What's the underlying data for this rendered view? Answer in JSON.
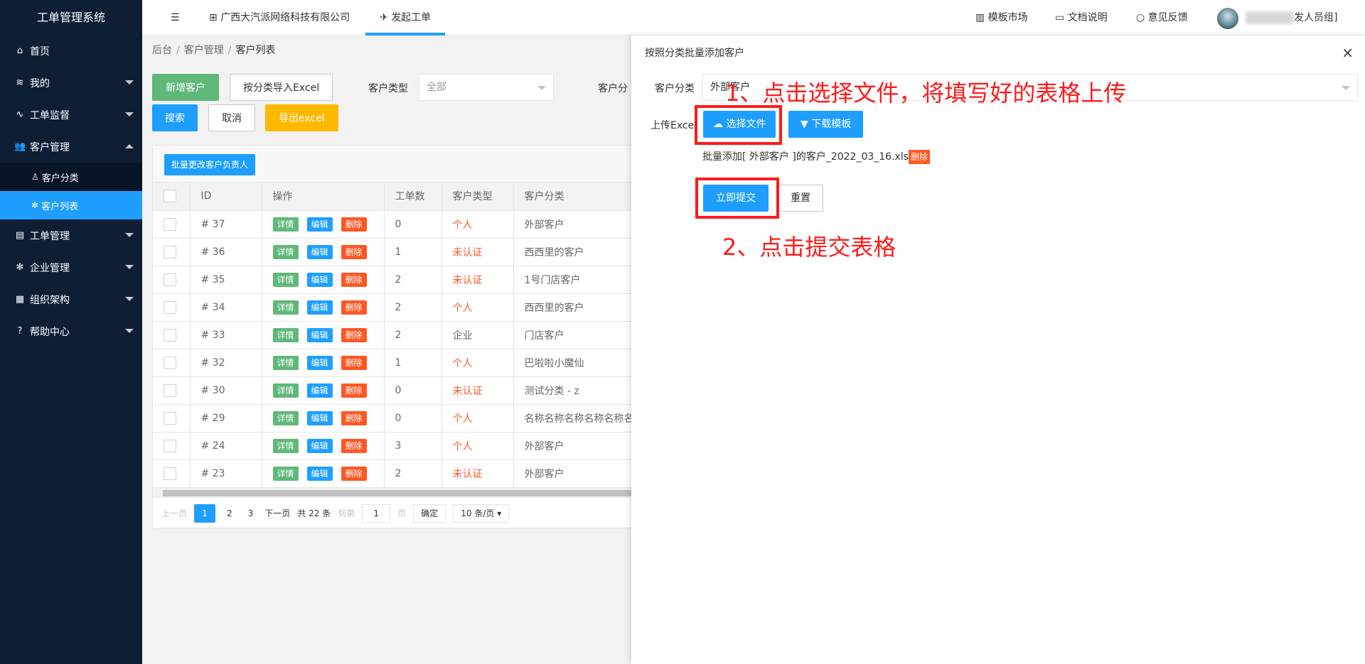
{
  "app": {
    "title": "工单管理系统"
  },
  "sidebar": {
    "items": [
      {
        "label": "首页",
        "icon": "home-icon"
      },
      {
        "label": "我的",
        "icon": "layers-icon"
      },
      {
        "label": "工单监督",
        "icon": "pulse-icon"
      },
      {
        "label": "客户管理",
        "icon": "users-icon"
      },
      {
        "label": "客户分类",
        "icon": "user-icon"
      },
      {
        "label": "客户列表",
        "icon": "gear-icon"
      },
      {
        "label": "工单管理",
        "icon": "clipboard-icon"
      },
      {
        "label": "企业管理",
        "icon": "gear-icon"
      },
      {
        "label": "组织架构",
        "icon": "calendar-icon"
      },
      {
        "label": "帮助中心",
        "icon": "question-icon"
      }
    ]
  },
  "header": {
    "menu_icon": "☰",
    "company": "广西大汽派网络科技有限公司",
    "launch": "发起工单",
    "template_market": "模板市场",
    "docs": "文档说明",
    "feedback": "意见反馈",
    "user_role": "发人员组]"
  },
  "breadcrumb": {
    "home": "后台",
    "section": "客户管理",
    "page": "客户列表",
    "sep": "/"
  },
  "toolbar": {
    "add": "新增客户",
    "import": "按分类导入Excel",
    "type_label": "客户类型",
    "type_value": "全部",
    "category_label": "客户分",
    "search": "搜索",
    "cancel": "取消",
    "export": "导出excel"
  },
  "table": {
    "batch_button": "批量更改客户负责人",
    "headers": [
      "ID",
      "操作",
      "工单数",
      "客户类型",
      "客户分类"
    ],
    "action_labels": {
      "detail": "详情",
      "edit": "编辑",
      "delete": "删除"
    },
    "rows": [
      {
        "id": "# 37",
        "count": "0",
        "type": "个人",
        "category": "外部客户"
      },
      {
        "id": "# 36",
        "count": "1",
        "type": "未认证",
        "category": "西西里的客户"
      },
      {
        "id": "# 35",
        "count": "2",
        "type": "未认证",
        "category": "1号门店客户"
      },
      {
        "id": "# 34",
        "count": "2",
        "type": "个人",
        "category": "西西里的客户"
      },
      {
        "id": "# 33",
        "count": "2",
        "type": "企业",
        "category": "门店客户"
      },
      {
        "id": "# 32",
        "count": "1",
        "type": "个人",
        "category": "巴啦啦小魔仙"
      },
      {
        "id": "# 30",
        "count": "0",
        "type": "未认证",
        "category": "测试分类 - z"
      },
      {
        "id": "# 29",
        "count": "0",
        "type": "个人",
        "category": "名称名称名称名称名称名"
      },
      {
        "id": "# 24",
        "count": "3",
        "type": "个人",
        "category": "外部客户"
      },
      {
        "id": "# 23",
        "count": "2",
        "type": "未认证",
        "category": "外部客户"
      }
    ]
  },
  "pager": {
    "prev": "上一页",
    "pages": [
      "1",
      "2",
      "3"
    ],
    "next": "下一页",
    "total": "共 22 条",
    "goto": "到第",
    "goto_value": "1",
    "page_unit": "页",
    "confirm": "确定",
    "per_page": "10 条/页 ▾"
  },
  "panel": {
    "title": "按照分类批量添加客户",
    "close": "×",
    "category_label": "客户分类",
    "category_value": "外部客户",
    "upload_label": "上传Excel",
    "choose_file": "选择文件",
    "download_template": "下载模板",
    "file_name": "批量添加[ 外部客户 ]的客户_2022_03_16.xls",
    "file_delete": "删除",
    "submit": "立即提交",
    "reset": "重置",
    "annotation_1": "1、点击选择文件，将填写好的表格上传",
    "annotation_2": "2、点击提交表格"
  }
}
